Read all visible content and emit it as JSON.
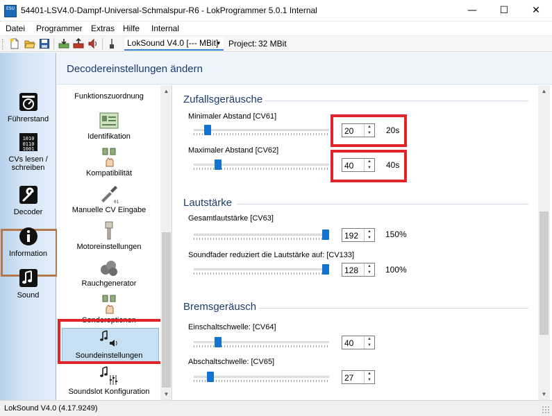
{
  "window": {
    "app_icon_text": "ESU",
    "title": "54401-LSV4.0-Dampf-Universal-Schmalspur-R6 - LokProgrammer 5.0.1 Internal",
    "min_symbol": "—",
    "max_symbol": "☐",
    "close_symbol": "✕"
  },
  "menu": {
    "items": [
      "Datei",
      "Programmer",
      "Extras",
      "Hilfe",
      "Internal"
    ]
  },
  "toolbar": {
    "icons": [
      "new-file-icon",
      "open-folder-icon",
      "save-icon",
      "read-decoder-icon",
      "write-decoder-icon",
      "play-sound-icon",
      "tool-icon"
    ],
    "decoder_type": "LokSound V4.0 [--- MBit]",
    "dropdown_arrow": "▾",
    "project_label": "Project:",
    "project_value": "32 MBit"
  },
  "leftnav": {
    "items": [
      {
        "label1": "Führerstand",
        "label2": "",
        "icon": "cab-gauge-icon"
      },
      {
        "label1": "CVs lesen /",
        "label2": "schreiben",
        "icon": "binary-data-icon"
      },
      {
        "label1": "Decoder",
        "label2": "",
        "icon": "wrench-icon"
      },
      {
        "label1": "Information",
        "label2": "",
        "icon": "info-icon"
      },
      {
        "label1": "Sound",
        "label2": "",
        "icon": "music-note-icon"
      }
    ],
    "selected": "Decoder"
  },
  "main": {
    "title": "Decodereinstellungen ändern"
  },
  "categories": {
    "items": [
      {
        "label": "Funktionszuordnung",
        "icon": "function-mapping-icon"
      },
      {
        "label": "Identifikation",
        "icon": "id-card-icon"
      },
      {
        "label": "Kompatibilität",
        "icon": "compatibility-icon"
      },
      {
        "label": "Manuelle CV Eingabe",
        "icon": "manual-cv-icon"
      },
      {
        "label": "Motoreinstellungen",
        "icon": "motor-piston-icon"
      },
      {
        "label": "Rauchgenerator",
        "icon": "smoke-icon"
      },
      {
        "label": "Sonderoptionen",
        "icon": "special-options-icon"
      },
      {
        "label": "Soundeinstellungen",
        "icon": "sound-settings-icon"
      },
      {
        "label": "Soundslot Konfiguration",
        "icon": "soundslot-icon"
      }
    ],
    "selected": "Soundeinstellungen"
  },
  "settings": {
    "groups": [
      {
        "title": "Zufallsgeräusche",
        "fields": [
          {
            "label": "Minimaler Abstand [CV61]",
            "value": "20",
            "extra": "20s",
            "slider_level": 0.08
          },
          {
            "label": "Maximaler Abstand [CV62]",
            "value": "40",
            "extra": "40s",
            "slider_level": 0.16
          }
        ]
      },
      {
        "title": "Lautstärke",
        "fields": [
          {
            "label": "Gesamtlautstärke [CV63]",
            "value": "192",
            "extra": "150%",
            "slider_level": 1.0
          },
          {
            "label": "Soundfader reduziert die Lautstärke auf: [CV133]",
            "value": "128",
            "extra": "100%",
            "slider_level": 1.0
          }
        ]
      },
      {
        "title": "Bremsgeräusch",
        "fields": [
          {
            "label": "Einschaltschwelle: [CV64]",
            "value": "40",
            "extra": "",
            "slider_level": 0.16
          },
          {
            "label": "Abschaltschwelle: [CV65]",
            "value": "27",
            "extra": "",
            "slider_level": 0.1
          }
        ]
      }
    ]
  },
  "status": {
    "text": "LokSound V4.0 (4.17.9249)"
  },
  "colors": {
    "accent": "#1374cf",
    "highlight_red": "#e0242b",
    "nav_selected_border": "#b3784b",
    "header_text": "#1c3c6c"
  }
}
